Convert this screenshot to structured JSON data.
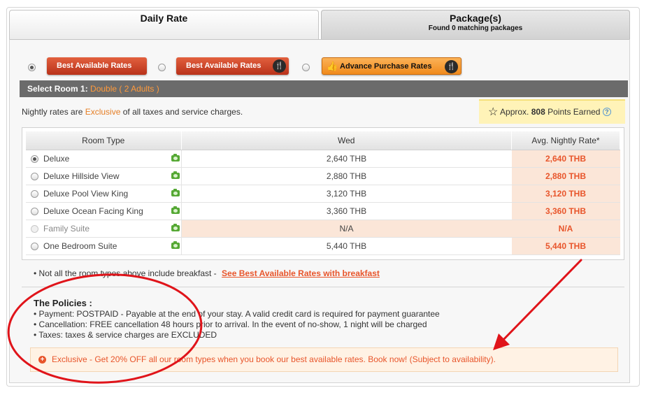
{
  "tabs": {
    "daily": {
      "label": "Daily Rate"
    },
    "packages": {
      "label": "Package(s)",
      "sub": "Found 0 matching packages"
    }
  },
  "rate_options": [
    {
      "label": "Best Available Rates",
      "selected": true
    },
    {
      "label": "Best Available Rates",
      "icon": "utensils-icon"
    },
    {
      "label": "Advance Purchase Rates",
      "icon": "utensils-icon"
    }
  ],
  "room_bar": {
    "label": "Select Room 1:",
    "selection": "Double ( 2 Adults )"
  },
  "nightly_note": {
    "prefix": "Nightly rates are ",
    "highlight": "Exclusive",
    "suffix": " of all taxes and service charges."
  },
  "points": {
    "prefix": "Approx.",
    "value": "808",
    "suffix": "Points Earned",
    "help": "?"
  },
  "table": {
    "headers": [
      "Room Type",
      "Wed",
      "Avg. Nightly Rate*"
    ],
    "rows": [
      {
        "type": "Deluxe",
        "wed": "2,640 THB",
        "avg": "2,640 THB"
      },
      {
        "type": "Deluxe Hillside View",
        "wed": "2,880 THB",
        "avg": "2,880 THB"
      },
      {
        "type": "Deluxe Pool View King",
        "wed": "3,120 THB",
        "avg": "3,120 THB"
      },
      {
        "type": "Deluxe Ocean Facing King",
        "wed": "3,360 THB",
        "avg": "3,360 THB"
      },
      {
        "type": "Family Suite",
        "wed": "N/A",
        "avg": "N/A"
      },
      {
        "type": "One Bedroom Suite",
        "wed": "5,440 THB",
        "avg": "5,440 THB"
      }
    ]
  },
  "breakfast": {
    "text": "• Not all the room types above include breakfast  -",
    "link": "See Best Available Rates with breakfast"
  },
  "policies": {
    "title": "The Policies :",
    "items": [
      "• Payment: POSTPAID - Payable at the end of your stay. A valid credit card is required for payment guarantee",
      "• Cancellation: FREE cancellation 48 hours prior to arrival. In the event of no-show, 1 night will be charged",
      "• Taxes: taxes & service charges are EXCLUDED"
    ]
  },
  "promo": {
    "text": "Exclusive - Get 20% OFF all our room types when you book our best available rates. Book now! (Subject to availability)."
  },
  "colors": {
    "accent": "#e8552b",
    "annotation": "#e0141a",
    "room_bar": "#6b6b6b"
  }
}
